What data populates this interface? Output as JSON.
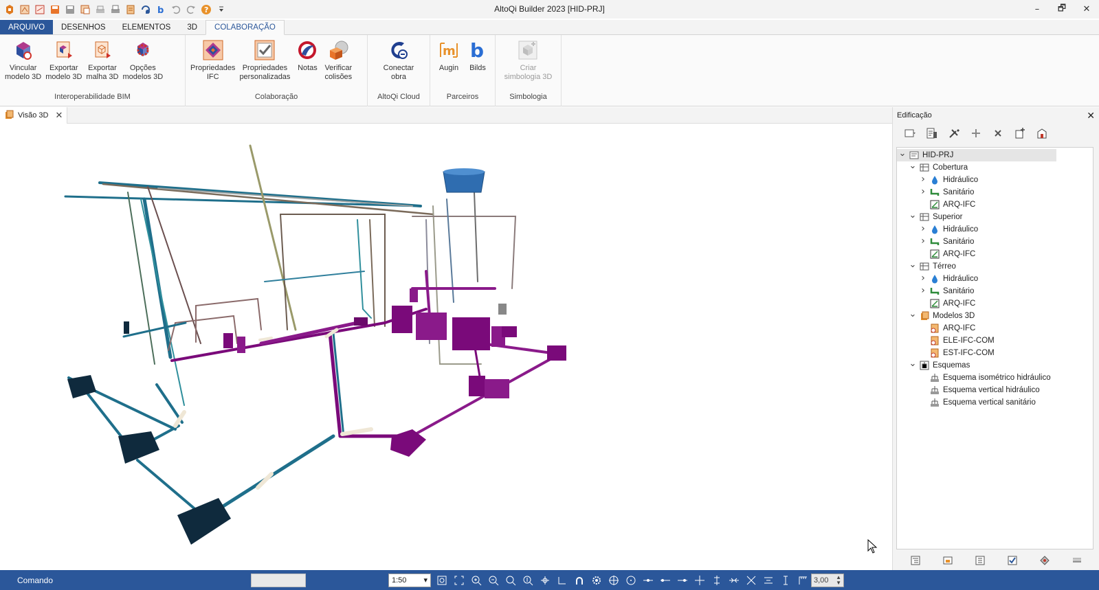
{
  "window": {
    "title": "AltoQi Builder 2023 [HID-PRJ]",
    "controls": [
      "–",
      "🗗",
      "✕"
    ]
  },
  "quick_access": [
    "app-menu-icon",
    "new-icon",
    "open-pdf-icon",
    "save-orange-icon",
    "save-icon",
    "save-as-icon",
    "print-preview-icon",
    "print-icon",
    "pages-icon",
    "sync-icon",
    "bilds-icon",
    "undo-icon",
    "redo-icon",
    "help-icon",
    "customize-icon"
  ],
  "ribbon_tabs": [
    "ARQUIVO",
    "DESENHOS",
    "ELEMENTOS",
    "3D",
    "COLABORAÇÃO"
  ],
  "active_tab": "COLABORAÇÃO",
  "ribbon_groups": [
    {
      "label": "Interoperabilidade BIM",
      "buttons": [
        {
          "label": "Vincular\nmodelo 3D",
          "icon": "link-model-icon"
        },
        {
          "label": "Exportar\nmodelo 3D",
          "icon": "export-model-icon"
        },
        {
          "label": "Exportar\nmalha 3D",
          "icon": "export-mesh-icon"
        },
        {
          "label": "Opções\nmodelos 3D",
          "icon": "model-options-icon"
        }
      ]
    },
    {
      "label": "Colaboração",
      "buttons": [
        {
          "label": "Propriedades\nIFC",
          "icon": "ifc-properties-icon"
        },
        {
          "label": "Propriedades\npersonalizadas",
          "icon": "custom-properties-icon"
        },
        {
          "label": "Notas",
          "icon": "notes-icon"
        },
        {
          "label": "Verificar\ncolisões",
          "icon": "check-collisions-icon"
        }
      ]
    },
    {
      "label": "AltoQi Cloud",
      "buttons": [
        {
          "label": "Conectar\nobra",
          "icon": "connect-project-icon"
        }
      ]
    },
    {
      "label": "Parceiros",
      "buttons": [
        {
          "label": "Augin",
          "icon": "augin-icon"
        },
        {
          "label": "Bilds",
          "icon": "bilds-icon"
        }
      ]
    },
    {
      "label": "Simbologia",
      "buttons": [
        {
          "label": "Criar\nsimbologia 3D",
          "icon": "create-3d-symbol-icon",
          "disabled": true
        }
      ]
    }
  ],
  "doc_tab": {
    "label": "Visão 3D",
    "close": "✕"
  },
  "panel": {
    "title": "Edificação",
    "close": "✕",
    "tree": [
      {
        "label": "HID-PRJ",
        "level": 0,
        "expanded": true,
        "icon": "project-icon",
        "selected": true
      },
      {
        "label": "Cobertura",
        "level": 1,
        "expanded": true,
        "icon": "floor-icon"
      },
      {
        "label": "Hidráulico",
        "level": 2,
        "expanded": false,
        "icon": "water-drop-icon"
      },
      {
        "label": "Sanitário",
        "level": 2,
        "expanded": false,
        "icon": "sanitary-icon"
      },
      {
        "label": "ARQ-IFC",
        "level": 2,
        "leaf": true,
        "icon": "architecture-icon"
      },
      {
        "label": "Superior",
        "level": 1,
        "expanded": true,
        "icon": "floor-icon"
      },
      {
        "label": "Hidráulico",
        "level": 2,
        "expanded": false,
        "icon": "water-drop-icon"
      },
      {
        "label": "Sanitário",
        "level": 2,
        "expanded": false,
        "icon": "sanitary-icon"
      },
      {
        "label": "ARQ-IFC",
        "level": 2,
        "leaf": true,
        "icon": "architecture-icon"
      },
      {
        "label": "Térreo",
        "level": 1,
        "expanded": true,
        "icon": "floor-icon"
      },
      {
        "label": "Hidráulico",
        "level": 2,
        "expanded": false,
        "icon": "water-drop-icon"
      },
      {
        "label": "Sanitário",
        "level": 2,
        "expanded": false,
        "icon": "sanitary-icon"
      },
      {
        "label": "ARQ-IFC",
        "level": 2,
        "leaf": true,
        "icon": "architecture-icon"
      },
      {
        "label": "Modelos 3D",
        "level": 1,
        "expanded": true,
        "icon": "models-3d-icon"
      },
      {
        "label": "ARQ-IFC",
        "level": 2,
        "leaf": true,
        "icon": "model-file-icon"
      },
      {
        "label": "ELE-IFC-COM",
        "level": 2,
        "leaf": true,
        "icon": "model-file-icon"
      },
      {
        "label": "EST-IFC-COM",
        "level": 2,
        "leaf": true,
        "icon": "model-file-icon"
      },
      {
        "label": "Esquemas",
        "level": 1,
        "expanded": true,
        "icon": "schemes-icon"
      },
      {
        "label": "Esquema isométrico hidráulico",
        "level": 2,
        "leaf": true,
        "icon": "scheme-icon"
      },
      {
        "label": "Esquema vertical hidráulico",
        "level": 2,
        "leaf": true,
        "icon": "scheme-icon"
      },
      {
        "label": "Esquema vertical sanitário",
        "level": 2,
        "leaf": true,
        "icon": "scheme-icon"
      }
    ]
  },
  "status": {
    "command_label": "Comando",
    "command_value": "",
    "scale": "1:50",
    "snap_value": "3,00"
  },
  "colors": {
    "accent": "#2b579a",
    "pipe_blue": "#1f6f8b",
    "pipe_purple": "#7a0a7a",
    "box_dark": "#0f2a3d",
    "tank_blue": "#2f6db0"
  }
}
